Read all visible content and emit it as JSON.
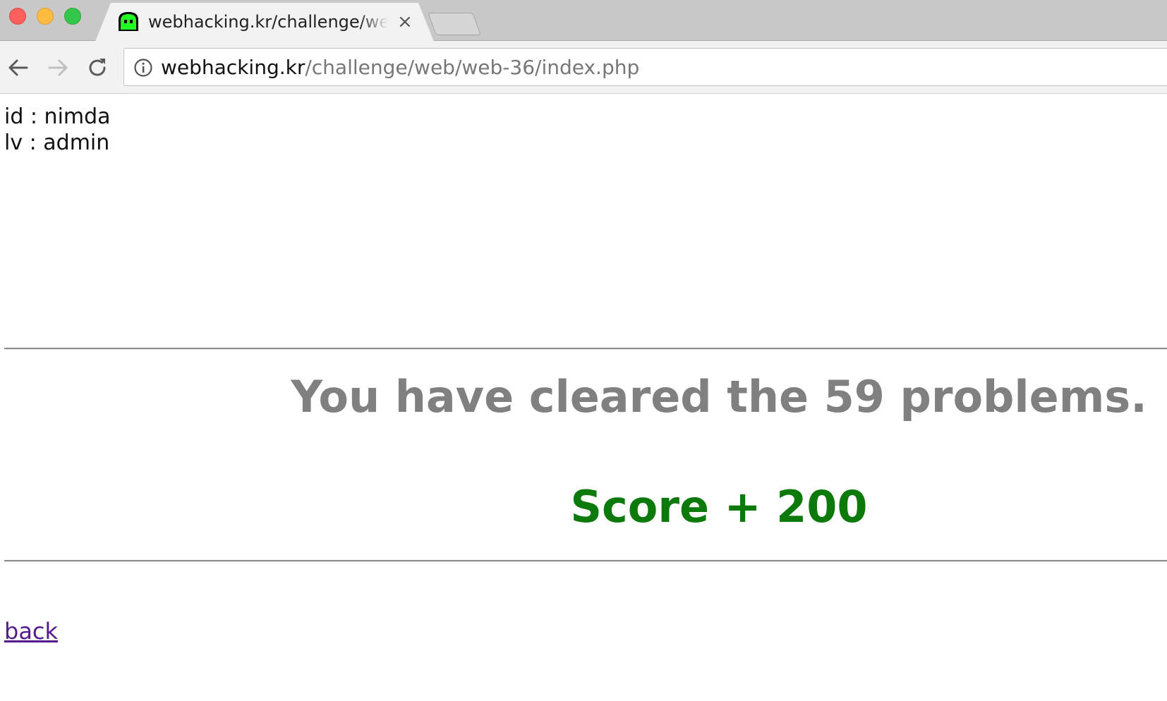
{
  "browser": {
    "tab_title": "webhacking.kr/challenge/web/web-36/index.php",
    "tab_close_glyph": "×",
    "url_host": "webhacking.kr",
    "url_path": "/challenge/web/web-36/index.php",
    "icons": {
      "favicon": "green-ghost-favicon",
      "back": "arrow-left-icon",
      "forward": "arrow-right-icon",
      "reload": "reload-icon",
      "site_info": "info-icon",
      "close": "close-icon"
    },
    "colors": {
      "traffic_close": "#fc605c",
      "traffic_minimize": "#fdbc40",
      "traffic_maximize": "#34c84a"
    }
  },
  "page": {
    "id_line": "id : nimda",
    "lv_line": "lv : admin",
    "cleared_message": "You have cleared the 59 problems.",
    "score_message": "Score + 200",
    "back_link": "back",
    "colors": {
      "cleared_text": "#808080",
      "score_text": "#0b7a0b",
      "link_visited": "#551a8b"
    }
  }
}
